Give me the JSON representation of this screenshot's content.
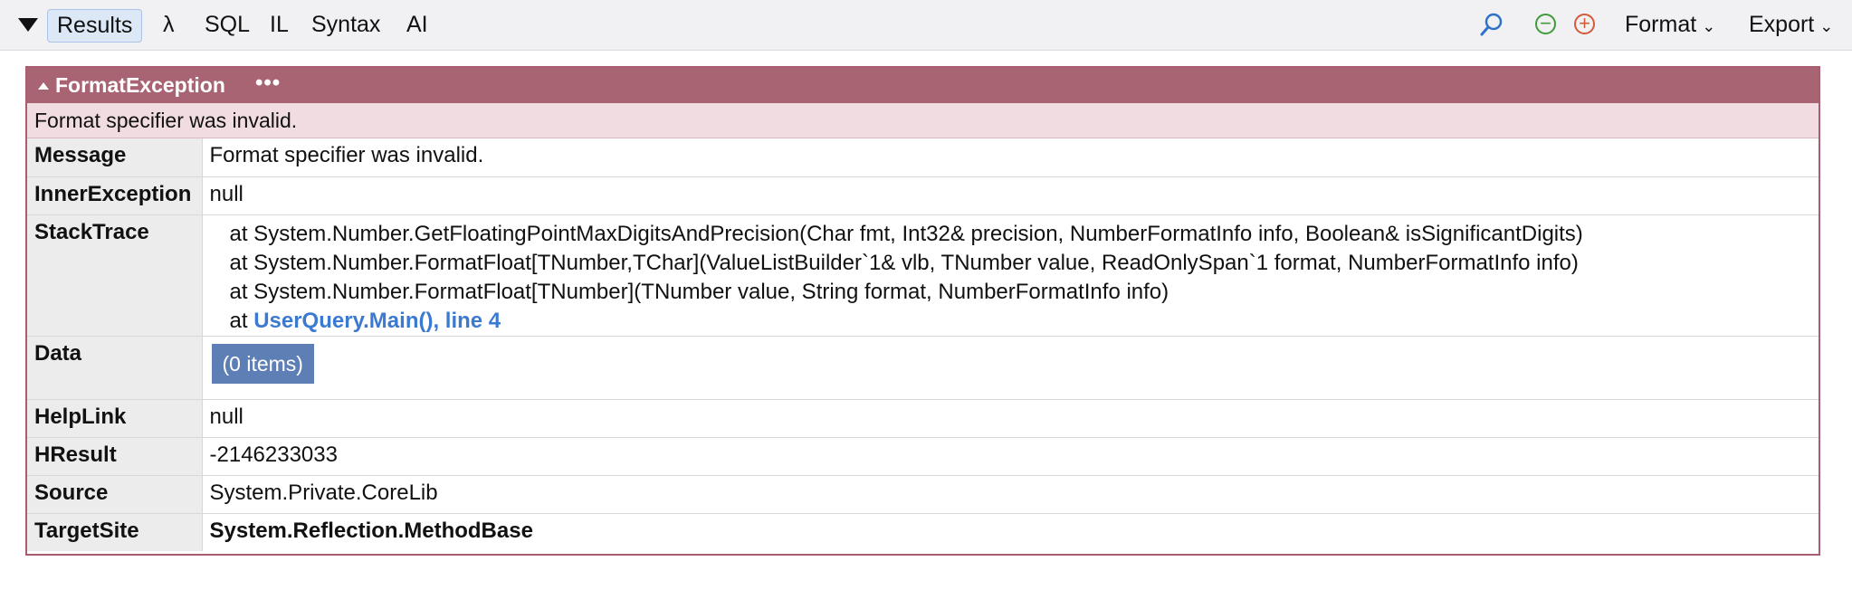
{
  "toolbar": {
    "tabs": [
      "Results",
      "λ",
      "SQL",
      "IL",
      "Syntax",
      "AI"
    ],
    "format_label": "Format",
    "export_label": "Export"
  },
  "exception": {
    "type": "FormatException",
    "more": "•••",
    "summary": "Format specifier was invalid.",
    "rows": {
      "message": {
        "key": "Message",
        "value": "Format specifier was invalid."
      },
      "inner": {
        "key": "InnerException",
        "value": "null"
      },
      "stack": {
        "key": "StackTrace",
        "lines": [
          "at System.Number.GetFloatingPointMaxDigitsAndPrecision(Char fmt, Int32& precision, NumberFormatInfo info, Boolean& isSignificantDigits)",
          "at System.Number.FormatFloat[TNumber,TChar](ValueListBuilder`1& vlb, TNumber value, ReadOnlySpan`1 format, NumberFormatInfo info)",
          "at System.Number.FormatFloat[TNumber](TNumber value, String format, NumberFormatInfo info)"
        ],
        "last_prefix": "at",
        "last_link": "UserQuery.Main(), line 4"
      },
      "data": {
        "key": "Data",
        "value": "(0 items)"
      },
      "helplink": {
        "key": "HelpLink",
        "value": "null"
      },
      "hresult": {
        "key": "HResult",
        "value": "-2146233033"
      },
      "source": {
        "key": "Source",
        "value": "System.Private.CoreLib"
      },
      "targetsite": {
        "key": "TargetSite",
        "value": "System.Reflection.MethodBase"
      }
    }
  },
  "icons": {
    "search": "magnifier-icon",
    "zoom_out": "minus-circle-icon",
    "zoom_in": "plus-circle-icon"
  },
  "colors": {
    "header": "#a96474",
    "summary_bg": "#f1dde1",
    "null": "#3e8a1e",
    "link": "#3b7ad0",
    "data_button": "#5e7fb5"
  }
}
